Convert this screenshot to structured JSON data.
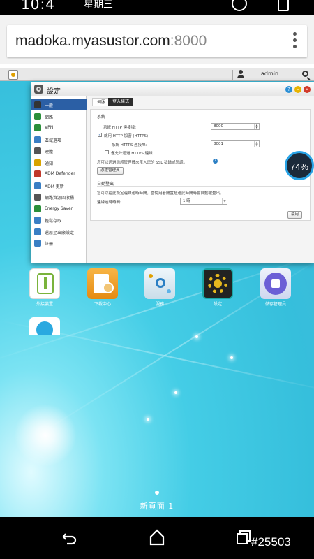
{
  "statusbar": {
    "time": "10:4",
    "day_of_week": "星期三"
  },
  "browser": {
    "url_host": "madoka.myasustor.com",
    "url_port": ":8000"
  },
  "adm_topbar": {
    "username": "admin"
  },
  "settings_window": {
    "title": "設定",
    "sidebar_items": [
      {
        "label": "一般",
        "icon": "monitor-icon",
        "color": "#333333"
      },
      {
        "label": "網路",
        "icon": "globe-icon",
        "color": "#2a8f3a"
      },
      {
        "label": "VPN",
        "icon": "vpn-icon",
        "color": "#2a8f3a"
      },
      {
        "label": "區域選項",
        "icon": "clock-globe-icon",
        "color": "#3a7fc4"
      },
      {
        "label": "硬體",
        "icon": "hardware-icon",
        "color": "#555555"
      },
      {
        "label": "通知",
        "icon": "bell-icon",
        "color": "#d9a400"
      },
      {
        "label": "ADM Defender",
        "icon": "shield-icon",
        "color": "#c0392b"
      },
      {
        "label": "ADM 更新",
        "icon": "update-icon",
        "color": "#3a7fc4"
      },
      {
        "label": "網路資源回收桶",
        "icon": "trash-icon",
        "color": "#555555"
      },
      {
        "label": "Energy Saver",
        "icon": "leaf-icon",
        "color": "#2a8f3a"
      },
      {
        "label": "輕鬆存取",
        "icon": "link-icon",
        "color": "#3a7fc4"
      },
      {
        "label": "還原至出廠設定",
        "icon": "restore-icon",
        "color": "#3a7fc4"
      },
      {
        "label": "註冊",
        "icon": "register-icon",
        "color": "#3a7fc4"
      }
    ],
    "tabs": [
      "伺服",
      "登入樣式"
    ],
    "system_section": {
      "title": "系統",
      "http_port_label": "系統 HTTP 連接埠:",
      "http_port_value": "8000",
      "enable_https_label": "啟用 HTTP 加密 (HTTPS)",
      "https_port_label": "系統 HTTPS 連接埠:",
      "https_port_value": "8001",
      "force_https_label": "僅允許透過 HTTPS 連線",
      "ssl_note": "您可以透過憑證管理員來匯入您的 SSL 私鑰或憑證。",
      "cert_manager_button": "憑證管理員"
    },
    "auto_logout_section": {
      "title": "自動登出",
      "note": "您可以在此設定連線逾時時間，當使用者閒置超過此時間時會自動被登出。",
      "timeout_label": "連線逾時時間:",
      "timeout_value": "1 時"
    },
    "apply_button": "套用"
  },
  "progress_bubble": {
    "percent": 0.74,
    "label": "74%"
  },
  "desktop_apps": [
    {
      "label": "外接裝置",
      "icon": "usb-icon"
    },
    {
      "label": "下載中心",
      "icon": "download-center-icon"
    },
    {
      "label": "服務",
      "icon": "services-icon"
    },
    {
      "label": "設定",
      "icon": "settings-gear-icon"
    },
    {
      "label": "儲存管理員",
      "icon": "storage-manager-icon"
    }
  ],
  "desktop": {
    "page_label": "新頁面 1"
  },
  "watermark": "#25503",
  "colors": {
    "accent": "#2b5fa5",
    "desktop_bg": "#44cde6",
    "progress_ring": "#28a3e6"
  }
}
